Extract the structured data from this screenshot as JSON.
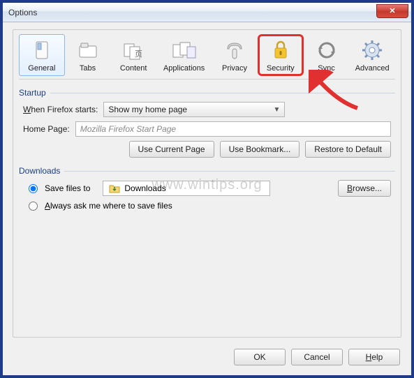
{
  "window": {
    "title": "Options"
  },
  "tabs": {
    "general": "General",
    "tabs": "Tabs",
    "content": "Content",
    "applications": "Applications",
    "privacy": "Privacy",
    "security": "Security",
    "sync": "Sync",
    "advanced": "Advanced"
  },
  "startup": {
    "section": "Startup",
    "when_label": "When Firefox starts:",
    "when_value": "Show my home page",
    "homepage_label": "Home Page:",
    "homepage_placeholder": "Mozilla Firefox Start Page",
    "use_current": "Use Current Page",
    "use_bookmark": "Use Bookmark...",
    "restore": "Restore to Default"
  },
  "downloads": {
    "section": "Downloads",
    "save_to": "Save files to",
    "folder": "Downloads",
    "browse": "Browse...",
    "always_ask": "Always ask me where to save files"
  },
  "footer": {
    "ok": "OK",
    "cancel": "Cancel",
    "help": "Help"
  },
  "watermark": "www.wintips.org"
}
